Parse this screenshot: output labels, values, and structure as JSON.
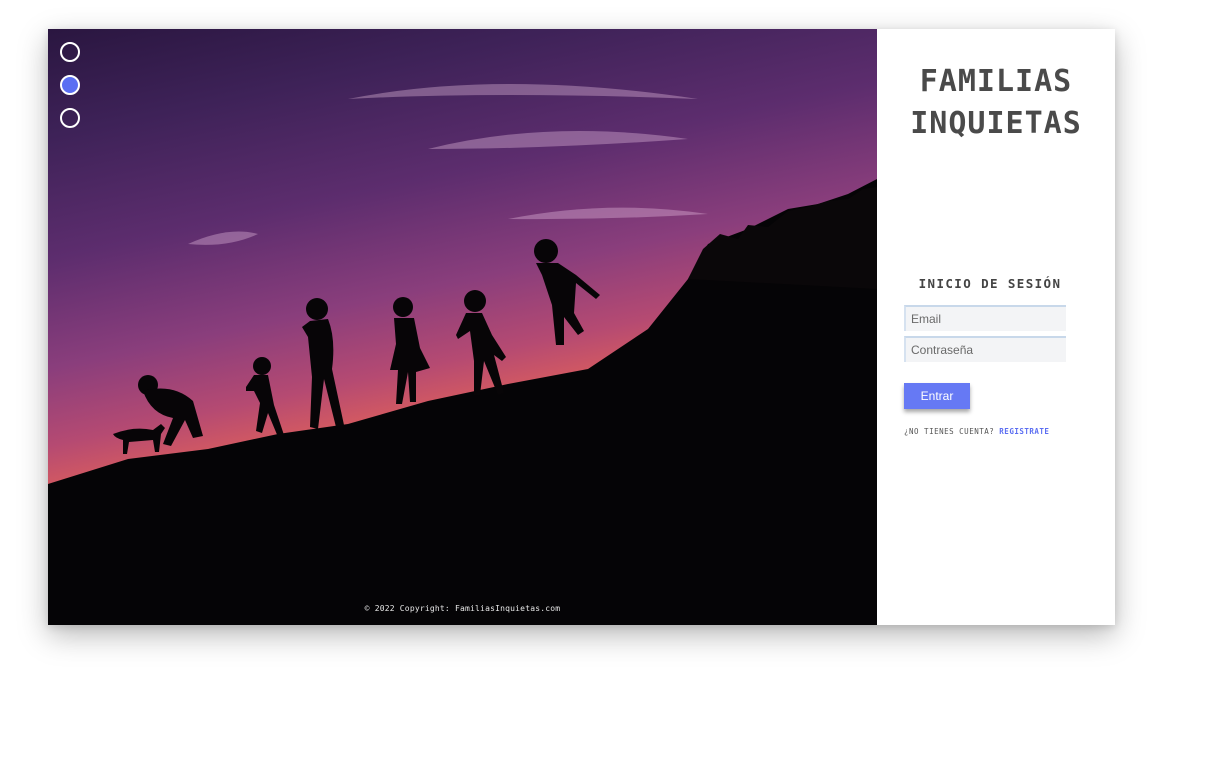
{
  "slider": {
    "dots": [
      {
        "label": "slide-1",
        "active": false
      },
      {
        "label": "slide-2",
        "active": true
      },
      {
        "label": "slide-3",
        "active": false
      }
    ]
  },
  "footer": {
    "copyright": "© 2022 Copyright: FamiliasInquietas.com"
  },
  "brand": {
    "line1": "FAMILIAS",
    "line2": "INQUIETAS"
  },
  "login": {
    "title": "INICIO DE SESIÓN",
    "email_placeholder": "Email",
    "password_placeholder": "Contraseña",
    "submit_label": "Entrar",
    "no_account_text": "¿NO TIENES CUENTA?",
    "signup_link": "REGISTRATE"
  },
  "colors": {
    "accent": "#6679f4",
    "brand_text": "#4a4a4a"
  }
}
